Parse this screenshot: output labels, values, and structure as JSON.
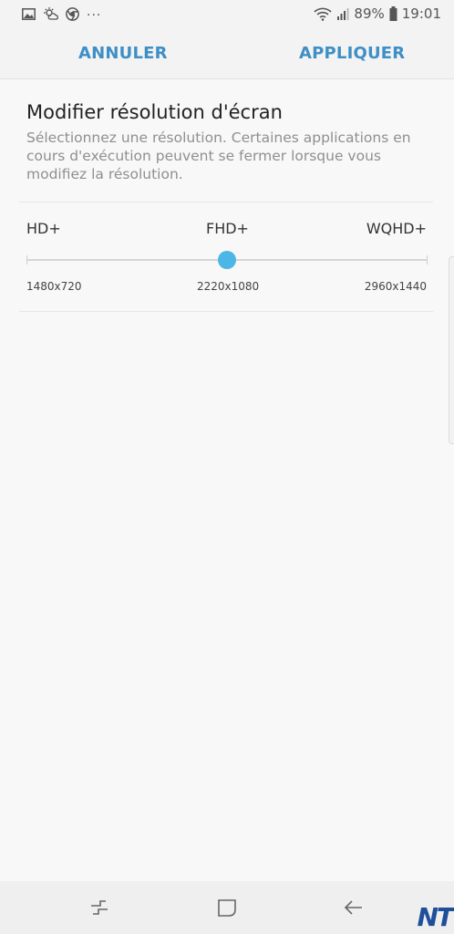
{
  "status_bar": {
    "left_icons": [
      "gallery-icon",
      "weather-icon",
      "chrome-icon"
    ],
    "more": "...",
    "battery": "89%",
    "time": "19:01"
  },
  "action_bar": {
    "cancel_label": "ANNULER",
    "apply_label": "APPLIQUER",
    "accent_color": "#3e8fc6"
  },
  "content": {
    "title": "Modifier résolution d'écran",
    "description": "Sélectionnez une résolution. Certaines applications en cours d'exécution peuvent se fermer lorsque vous modifiez la résolution."
  },
  "resolution_slider": {
    "options": [
      {
        "label": "HD+",
        "value": "1480x720"
      },
      {
        "label": "FHD+",
        "value": "2220x1080"
      },
      {
        "label": "WQHD+",
        "value": "2960x1440"
      }
    ],
    "selected_index": 1,
    "thumb_color": "#4cb6e6"
  },
  "nav_bar": {
    "buttons": [
      "recent-apps-icon",
      "home-icon",
      "back-icon"
    ]
  },
  "watermark": "NT"
}
